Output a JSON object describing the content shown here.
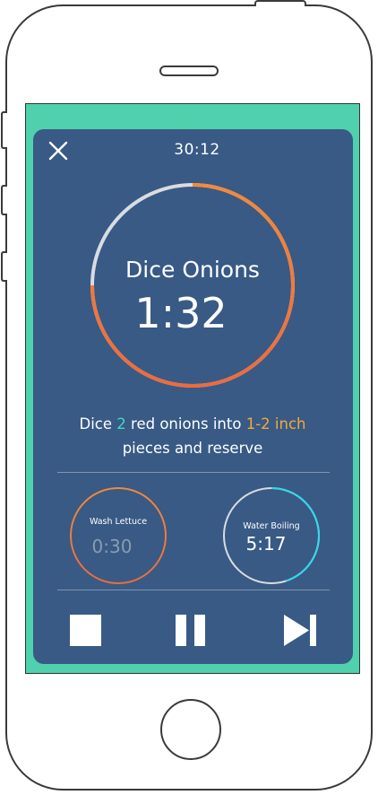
{
  "colors": {
    "accent_green": "#4fd1ad",
    "card_bg": "#385a85",
    "accent_teal": "#47d6c4",
    "accent_orange": "#f2a93b",
    "ring_gray": "#d9dce1",
    "ring_orange": "#f5893a",
    "ring_red_orange": "#ee6a3c",
    "ring_teal": "#32d8e8"
  },
  "header": {
    "close_icon": "close-icon",
    "total_time": "30:12"
  },
  "current_step": {
    "name": "Dice Onions",
    "time": "1:32",
    "progress_remaining": 0.75
  },
  "instruction": {
    "part1": "Dice ",
    "qty": "2",
    "part2": " red onions into ",
    "size": "1-2 inch",
    "part3": " pieces and reserve"
  },
  "timers": [
    {
      "label": "Wash Lettuce",
      "time": "0:30",
      "status": "pending"
    },
    {
      "label": "Water Boiling",
      "time": "5:17",
      "progress": 0.45
    }
  ],
  "controls": {
    "stop_icon": "stop-icon",
    "pause_icon": "pause-icon",
    "skip_icon": "skip-next-icon"
  }
}
